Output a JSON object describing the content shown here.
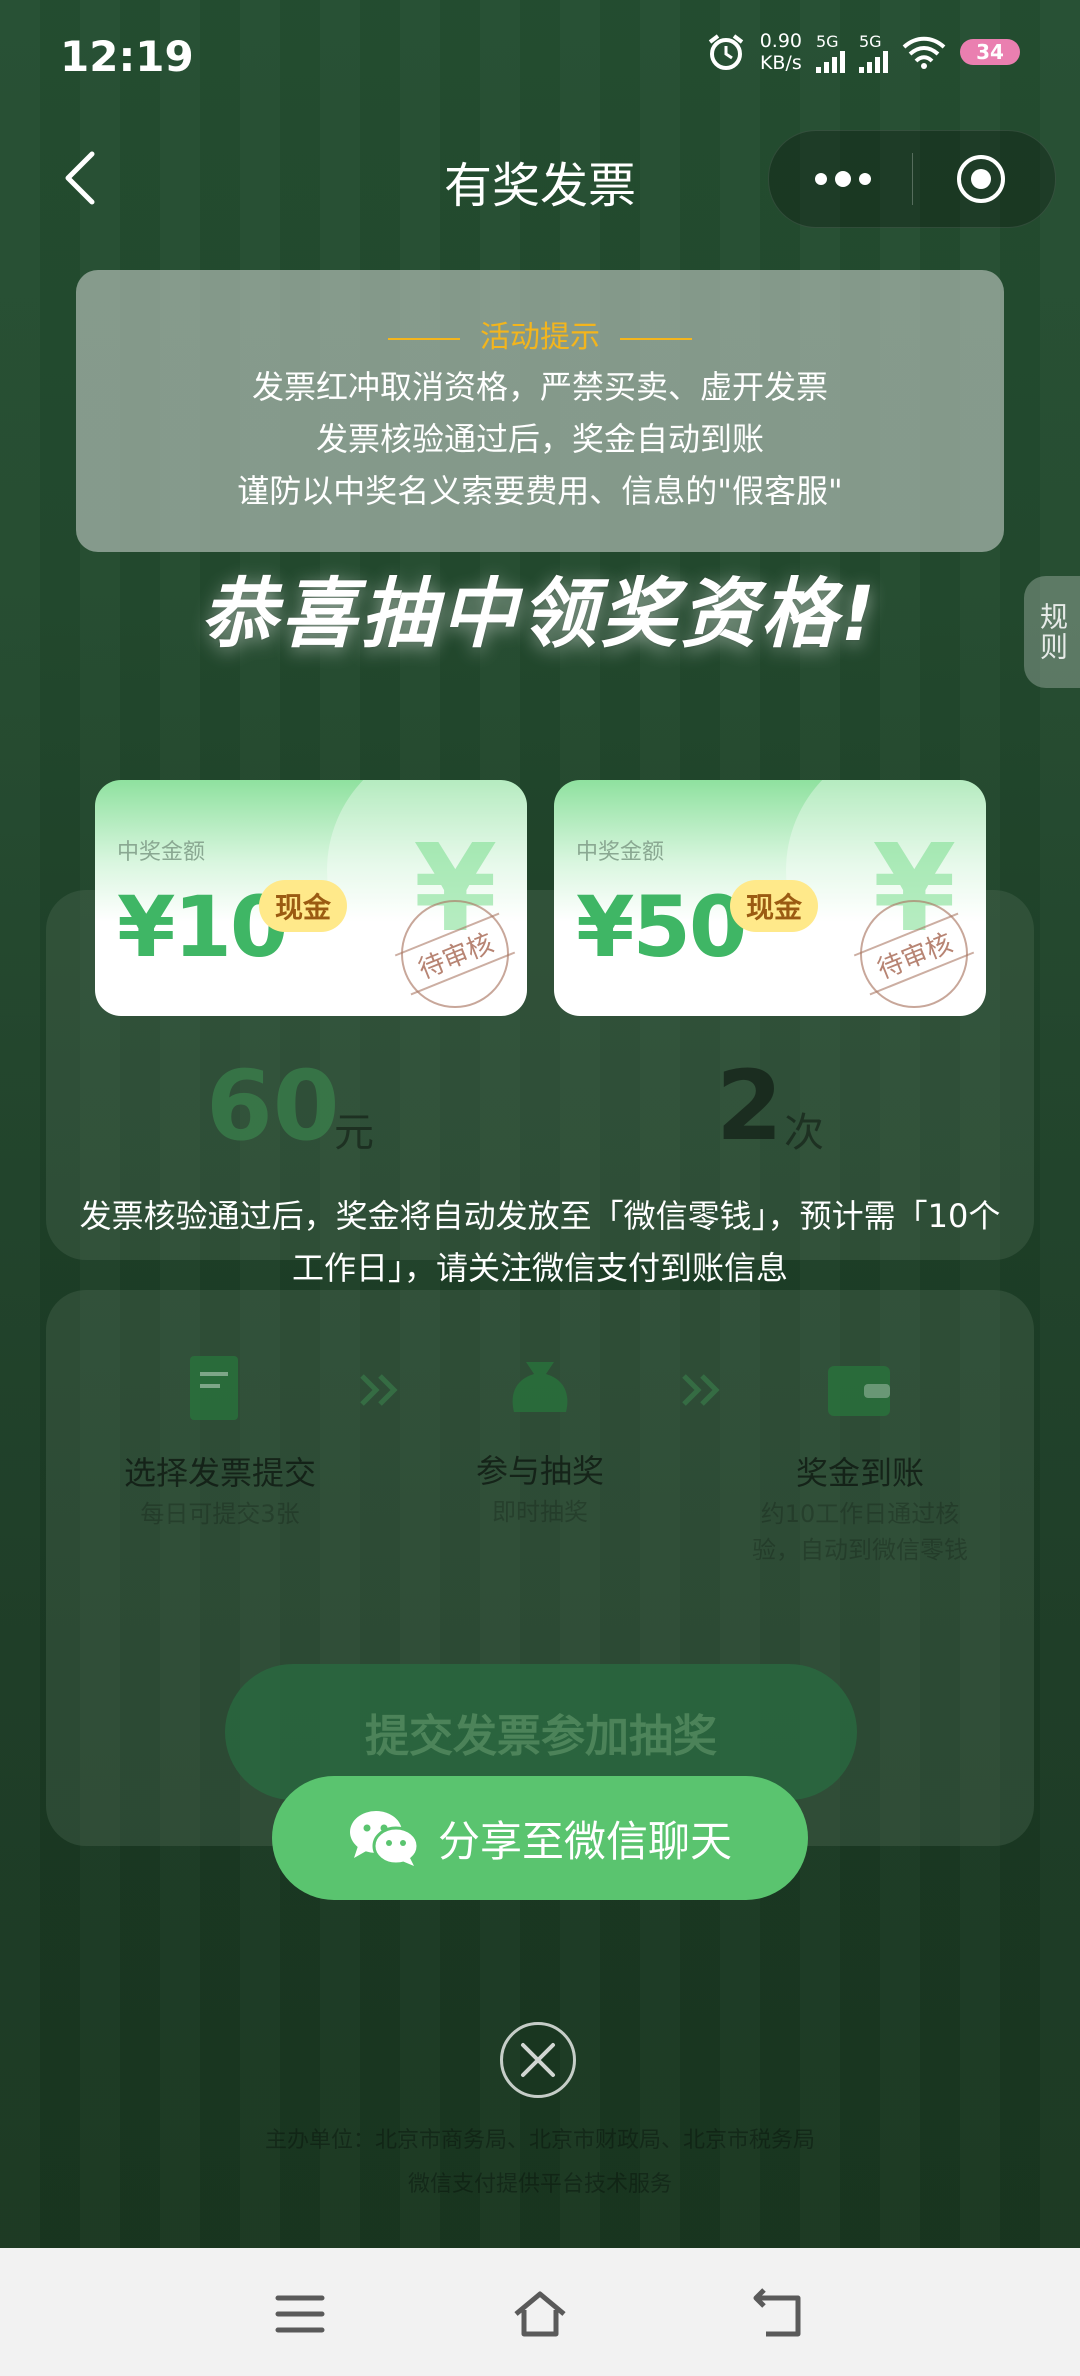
{
  "status_bar": {
    "time": "12:19",
    "net_speed_value": "0.90",
    "net_speed_unit": "KB/s",
    "sim1": "5G",
    "sim2": "5G",
    "battery": "34"
  },
  "header": {
    "title": "有奖发票"
  },
  "activity_tip": {
    "title": "活动提示",
    "lines": [
      "发票红冲取消资格，严禁买卖、虚开发票",
      "发票核验通过后，奖金自动到账",
      "谨防以中奖名义索要费用、信息的\"假客服\""
    ]
  },
  "congrats": "恭喜抽中领奖资格!",
  "rules_tab": "规则",
  "prizes": [
    {
      "label": "中奖金额",
      "amount": "¥10",
      "tag": "现金",
      "status": "待审核",
      "bg_symbol": "¥"
    },
    {
      "label": "中奖金额",
      "amount": "¥50",
      "tag": "现金",
      "status": "待审核",
      "bg_symbol": "¥"
    }
  ],
  "background_page": {
    "stats": [
      {
        "value": "60",
        "unit": "元"
      },
      {
        "value": "2",
        "unit": "次"
      }
    ],
    "steps": [
      {
        "title": "选择发票提交",
        "sub": "每日可提交3张"
      },
      {
        "title": "参与抽奖",
        "sub": "即时抽奖"
      },
      {
        "title": "奖金到账",
        "sub": "约10工作日通过核验，自动到微信零钱"
      }
    ],
    "submit_button": "提交发票参加抽奖",
    "footer_line1": "主办单位：北京市商务局、北京市财政局、北京市税务局",
    "footer_line2": "微信支付提供平台技术服务"
  },
  "notice": "发票核验通过后，奖金将自动发放至「微信零钱」，预计需「10个工作日」，请关注微信支付到账信息",
  "share_button": "分享至微信聊天",
  "colors": {
    "accent_green": "#5ac46f",
    "amount_green": "#3fb665",
    "tip_gold": "#f3b51d",
    "tag_yellow": "#ffe98a"
  }
}
